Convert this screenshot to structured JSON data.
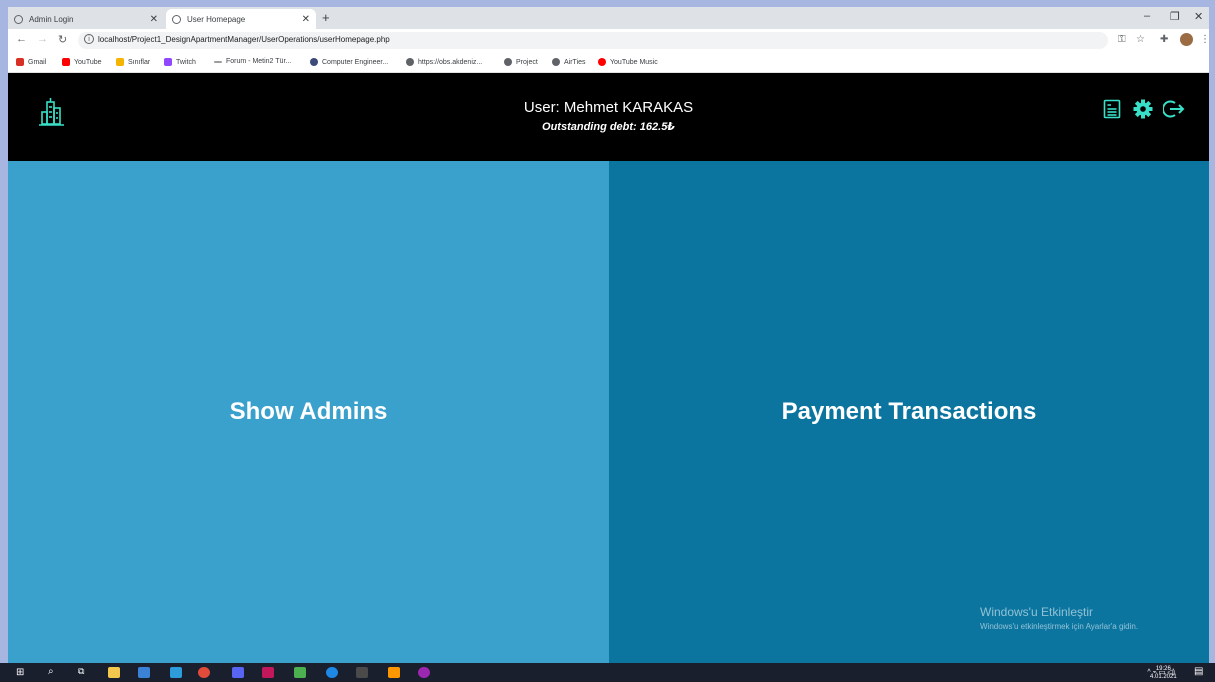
{
  "browser": {
    "tabs": [
      {
        "label": "Admin Login",
        "active": false
      },
      {
        "label": "User Homepage",
        "active": true
      }
    ],
    "new_tab_label": "+",
    "url": "localhost/Project1_DesignApartmentManager/UserOperations/userHomepage.php",
    "bookmarks": [
      {
        "label": "Gmail",
        "color": "#d93025"
      },
      {
        "label": "YouTube",
        "color": "#ff0000"
      },
      {
        "label": "Sınıflar",
        "color": "#f4b400"
      },
      {
        "label": "Twitch",
        "color": "#9146ff"
      },
      {
        "label": "Forum - Metin2 Tür...",
        "color": "#9e9e9e"
      },
      {
        "label": "Computer Engineer...",
        "color": "#3c4a7a"
      },
      {
        "label": "https://obs.akdeniz...",
        "color": "#5f6368"
      },
      {
        "label": "Project",
        "color": "#5f6368"
      },
      {
        "label": "AirTies",
        "color": "#5f6368"
      },
      {
        "label": "YouTube Music",
        "color": "#ff0000"
      }
    ]
  },
  "header": {
    "user_label": "User: Mehmet KARAKAS",
    "debt_label": "Outstanding debt: 162.5₺",
    "accent_color": "#38e0c8"
  },
  "panels": {
    "left": {
      "label": "Show Admins",
      "color": "#3aa0cc"
    },
    "right": {
      "label": "Payment Transactions",
      "color": "#0b75a0"
    }
  },
  "watermark": {
    "title": "Windows'u Etkinleştir",
    "subtitle": "Windows'u etkinleştirmek için Ayarlar'a gidin."
  },
  "taskbar": {
    "time": "19:26",
    "date": "4.01.2021"
  }
}
